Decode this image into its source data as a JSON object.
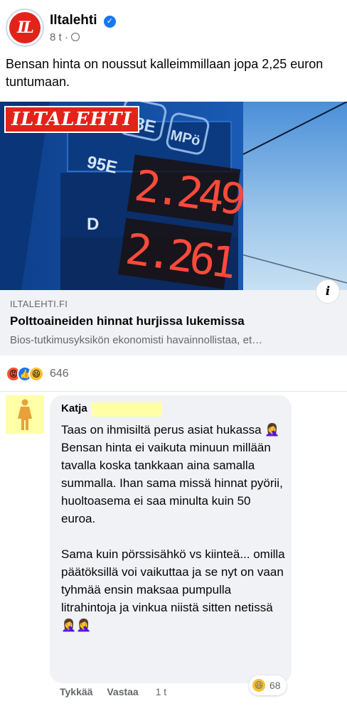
{
  "post": {
    "page_name": "Iltalehti",
    "avatar_text": "IL",
    "time": "8 t",
    "separator": "·",
    "text": "Bensan hinta on noussut kalleimmillaan jopa 2,25 euron tuntumaan."
  },
  "link_card": {
    "logo_text": "ILTALEHTI",
    "sign": {
      "row1_label": "95E",
      "row1_price": "2.249",
      "row2_label": "D",
      "row2_price": "2.261",
      "top_label_1": "98E",
      "top_label_2": "MPö"
    },
    "domain": "ILTALEHTI.FI",
    "title": "Polttoaineiden hinnat hurjissa lukemissa",
    "description": "Bios-tutkimusyksikön ekonomisti havainnollistaa, et…",
    "info_label": "i"
  },
  "reactions": {
    "count": "646",
    "types": [
      "angry-icon",
      "like-icon",
      "haha-icon"
    ]
  },
  "comment": {
    "author": "Katja",
    "body": "Taas on ihmisiltä perus asiat hukassa 🤦‍♀️ Bensan hinta ei vaikuta minuun millään tavalla koska tankkaan aina samalla summalla. Ihan sama missä hinnat pyörii, huoltoasema ei saa minulta kuin 50 euroa.\n\nSama kuin pörssisähkö vs kiinteä... omilla päätöksillä voi vaikuttaa ja se nyt on vaan tyhmää ensin maksaa pumpulla litrahintoja ja vinkua niistä sitten netissä 🤦‍♀️🤦‍♀️",
    "like_label": "Tykkää",
    "reply_label": "Vastaa",
    "time": "1 t",
    "reaction_count": "68"
  },
  "colors": {
    "brand_red": "#e2231a",
    "facebook_blue": "#1877f2",
    "bubble_grey": "#f0f2f5",
    "redaction_yellow": "#ffffa8"
  }
}
